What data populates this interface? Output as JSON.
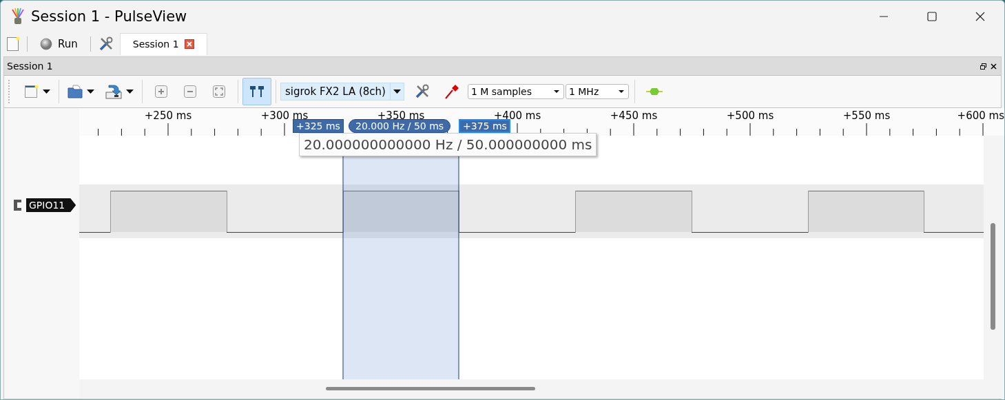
{
  "window": {
    "title": "Session 1 - PulseView"
  },
  "main_toolbar": {
    "run_button": "Run",
    "tabs": [
      {
        "label": "Session 1",
        "selected": true
      }
    ]
  },
  "dock": {
    "title": "Session 1"
  },
  "session_toolbar": {
    "device": "sigrok FX2 LA (8ch)",
    "samples": "1 M samples",
    "samplerate": "1 MHz",
    "cursors_on": true
  },
  "ruler": {
    "labels": [
      "+250 ms",
      "+300 ms",
      "+350 ms",
      "+400 ms",
      "+450 ms",
      "+500 ms",
      "+550 ms",
      "+600 ms"
    ]
  },
  "cursors": {
    "left": "+325 ms",
    "width": "20.000 Hz / 50 ms",
    "right": "+375 ms",
    "right_selected": true,
    "tooltip": "20.000000000000 Hz / 50.000000000 ms"
  },
  "signals": [
    {
      "name": "GPIO11"
    }
  ]
}
